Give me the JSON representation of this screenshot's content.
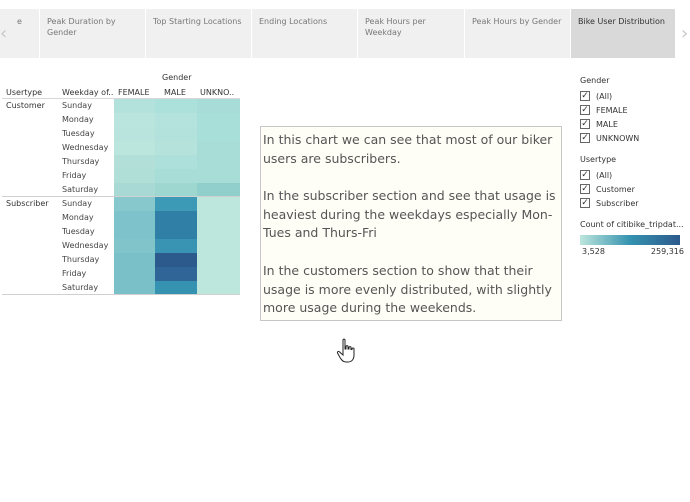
{
  "tabs": [
    {
      "label": "e",
      "active": false
    },
    {
      "label": "Peak Duration by Gender",
      "active": false
    },
    {
      "label": "Top Starting Locations",
      "active": false
    },
    {
      "label": "Ending Locations",
      "active": false
    },
    {
      "label": "Peak Hours per Weekday",
      "active": false
    },
    {
      "label": "Peak Hours by Gender",
      "active": false
    },
    {
      "label": "Bike User Distribution",
      "active": true
    }
  ],
  "nav": {
    "left": "‹",
    "right": "›"
  },
  "heatmap": {
    "gender_title": "Gender",
    "usertype_header": "Usertype",
    "weekday_header": "Weekday of..",
    "columns": [
      "FEMALE",
      "MALE",
      "UNKNO.."
    ],
    "groups": [
      {
        "name": "Customer",
        "days": [
          "Sunday",
          "Monday",
          "Tuesday",
          "Wednesday",
          "Thursday",
          "Friday",
          "Saturday"
        ]
      },
      {
        "name": "Subscriber",
        "days": [
          "Sunday",
          "Monday",
          "Tuesday",
          "Wednesday",
          "Thursday",
          "Friday",
          "Saturday"
        ]
      }
    ],
    "colors": [
      [
        "#b3e1db",
        "#ace0da",
        "#a8dcd8"
      ],
      [
        "#b9e5de",
        "#b4e2dc",
        "#a8dfd9"
      ],
      [
        "#b8e4dd",
        "#b3e2dc",
        "#a8dfd9"
      ],
      [
        "#bbe6de",
        "#b5e3dc",
        "#a8dcd6"
      ],
      [
        "#b2e0d9",
        "#ade0da",
        "#a8dcd6"
      ],
      [
        "#b0dfd8",
        "#a8dcd6",
        "#a8dcd6"
      ],
      [
        "#a8d9d4",
        "#9ed6d0",
        "#90cfcc"
      ],
      [
        "#86c8cc",
        "#3d9ab7",
        "#bde6dc"
      ],
      [
        "#7ec3cb",
        "#2f7fa6",
        "#bde6dc"
      ],
      [
        "#7ec3cb",
        "#2f7fa6",
        "#bde6dc"
      ],
      [
        "#81c5cb",
        "#3994b3",
        "#bde6dc"
      ],
      [
        "#79c0c9",
        "#2d5a8c",
        "#bde6dc"
      ],
      [
        "#79c0c9",
        "#2f6597",
        "#bde6dc"
      ],
      [
        "#79c0c9",
        "#3592b0",
        "#bde6dc"
      ]
    ]
  },
  "annotation": {
    "p1": "In this chart we can see that most of our biker users are subscribers.",
    "p2": "In  the subscriber section and see that usage is heaviest during the weekdays especially Mon-Tues and Thurs-Fri",
    "p3": "In the customers section to show that their usage is more evenly distributed, with slightly more usage during the weekends."
  },
  "legend": {
    "gender_title": "Gender",
    "gender_items": [
      "(All)",
      "FEMALE",
      "MALE",
      "UNKNOWN"
    ],
    "usertype_title": "Usertype",
    "usertype_items": [
      "(All)",
      "Customer",
      "Subscriber"
    ],
    "count_title": "Count of citibike_tripdat...",
    "min": "3,528",
    "max": "259,316"
  }
}
